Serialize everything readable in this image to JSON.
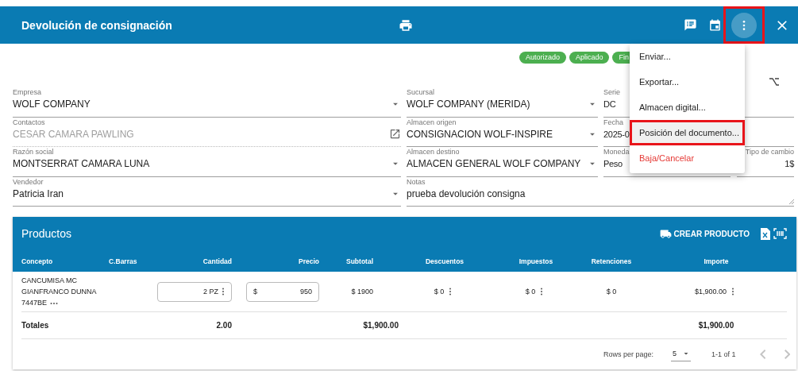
{
  "header": {
    "title": "Devolución de consignación",
    "menu_button": {
      "highlighted": true
    }
  },
  "status_chips": [
    {
      "label": "Autorizado"
    },
    {
      "label": "Aplicado"
    },
    {
      "label": "Fin"
    }
  ],
  "form": {
    "columns": [
      [
        {
          "label": "Empresa",
          "value": "WOLF COMPANY",
          "kind": "select",
          "disabled": false
        },
        {
          "label": "Contactos",
          "value": "CESAR CAMARA PAWLING",
          "kind": "link",
          "disabled": true
        },
        {
          "label": "Razón social",
          "value": "MONTSERRAT CAMARA LUNA",
          "kind": "select",
          "disabled": false
        },
        {
          "label": "Vendedor",
          "value": "Patricia Iran",
          "kind": "select",
          "disabled": false
        }
      ],
      [
        {
          "label": "Sucursal",
          "value": "WOLF COMPANY (MERIDA)",
          "kind": "select",
          "disabled": false
        },
        {
          "label": "Almacen origen",
          "value": "CONSIGNACION WOLF-INSPIRE",
          "kind": "select",
          "disabled": false
        },
        {
          "label": "Almacen destino",
          "value": "ALMACEN GENERAL WOLF COMPANY",
          "kind": "select",
          "disabled": false
        },
        {
          "label": "Notas",
          "value": "prueba devolución consigna",
          "kind": "textarea",
          "disabled": false
        }
      ],
      [
        {
          "label": "Serie",
          "value": "DC",
          "kind": "text",
          "disabled": false
        },
        {
          "label": "Fecha",
          "value": "2025-0",
          "kind": "text",
          "disabled": false
        },
        {
          "label": "Moneda",
          "value": "Peso",
          "kind": "text",
          "disabled": false
        },
        {
          "label": "Tipo de cambio",
          "value": "1$",
          "kind": "number",
          "disabled": false
        }
      ]
    ]
  },
  "menu": {
    "items": [
      {
        "label": "Enviar...",
        "highlighted": false,
        "danger": false
      },
      {
        "label": "Exportar...",
        "highlighted": false,
        "danger": false
      },
      {
        "label": "Almacen digital...",
        "highlighted": false,
        "danger": false
      },
      {
        "label": "Posición del documento...",
        "highlighted": true,
        "danger": false
      },
      {
        "label": "Baja/Cancelar",
        "highlighted": false,
        "danger": true
      }
    ]
  },
  "products": {
    "title": "Productos",
    "create_button": "CREAR PRODUCTO",
    "columns": [
      "Concepto",
      "C.Barras",
      "Cantidad",
      "Precio",
      "Subtotal",
      "Descuentos",
      "Impuestos",
      "Retenciones",
      "Importe"
    ],
    "rows": [
      {
        "concepto": "CANCUMISA MC GIANFRANCO DUNNA 7447BE",
        "cantidad": "2 PZ",
        "precio_prefix": "$",
        "precio": "950",
        "subtotal": "$ 1900",
        "descuentos": "$ 0",
        "impuestos": "$ 0",
        "retenciones": "$ 0",
        "importe": "$1,900.00"
      }
    ],
    "totals": {
      "label": "Totales",
      "cantidad": "2.00",
      "subtotal": "$1,900.00",
      "importe": "$1,900.00"
    },
    "pagination": {
      "rows_label": "Rows per page:",
      "rows_value": "5",
      "range": "1-1 of 1",
      "prev_disabled": true,
      "next_disabled": true
    }
  }
}
